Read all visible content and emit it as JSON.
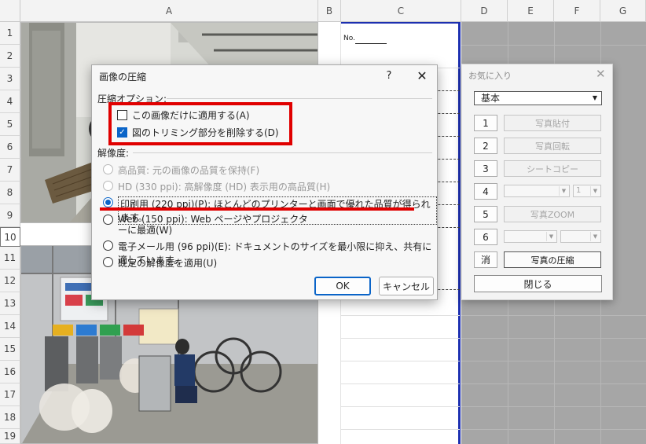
{
  "columns": [
    "A",
    "B",
    "C",
    "D",
    "E",
    "F",
    "G"
  ],
  "rows": [
    "1",
    "2",
    "3",
    "4",
    "5",
    "6",
    "7",
    "8",
    "9",
    "10",
    "11",
    "12",
    "13",
    "14",
    "15",
    "16",
    "17",
    "18",
    "19"
  ],
  "selected_row": "10",
  "cell_c1": "No.",
  "dialog": {
    "title": "画像の圧縮",
    "help": "?",
    "close": "✕",
    "compress_section": "圧縮オプション:",
    "apply_only_this": "この画像だけに適用する(A)",
    "apply_only_this_checked": false,
    "delete_cropped": "図のトリミング部分を削除する(D)",
    "delete_cropped_checked": true,
    "resolution_section": "解像度:",
    "resolutions": [
      {
        "label": "高品質: 元の画像の品質を保持(F)",
        "disabled": true,
        "selected": false
      },
      {
        "label": "HD (330 ppi): 高解像度 (HD) 表示用の高品質(H)",
        "disabled": true,
        "selected": false
      },
      {
        "label": "印刷用 (220 ppi)(P): ほとんどのプリンターと画面で優れた品質が得られます。",
        "disabled": false,
        "selected": true
      },
      {
        "label": "Web (150 ppi): Web ページやプロジェクターに最適(W)",
        "disabled": false,
        "selected": false
      },
      {
        "label": "電子メール用 (96 ppi)(E): ドキュメントのサイズを最小限に抑え、共有に適しています。",
        "disabled": false,
        "selected": false
      },
      {
        "label": "既定の解像度を適用(U)",
        "disabled": false,
        "selected": false
      }
    ],
    "ok": "OK",
    "cancel": "キャンセル"
  },
  "favorites": {
    "title": "お気に入り",
    "close": "✕",
    "preset": "基本",
    "num_buttons": [
      "1",
      "2",
      "3",
      "4",
      "5",
      "6"
    ],
    "clear": "消",
    "btn_paste_photo": "写真貼付",
    "btn_rotate_photo": "写真回転",
    "btn_sheet_copy": "シートコピー",
    "combo_4_value": "1",
    "btn_photo_zoom": "写真ZOOM",
    "btn_compress": "写真の圧縮",
    "btn_close": "閉じる"
  }
}
